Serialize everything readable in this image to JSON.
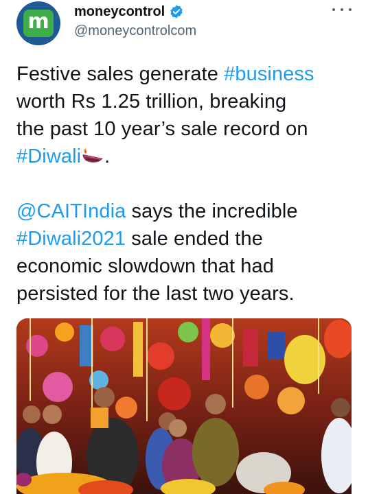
{
  "author": {
    "name": "moneycontrol",
    "handle": "@moneycontrolcom",
    "avatar_letter": "m",
    "verified": true
  },
  "tweet": {
    "p1_l1_a": "Festive sales generate ",
    "p1_l1_tag": "#business",
    "p1_l2": "worth Rs 1.25 trillion, breaking",
    "p1_l3": "the past 10 year’s sale record on",
    "p1_l4_tag": "#Diwali",
    "p1_l4_b": ".",
    "p2_l1_mention": "@CAITIndia",
    "p2_l1_b": " says the incredible",
    "p2_l2_tag": "#Diwali2021",
    "p2_l2_b": " sale ended the",
    "p2_l3": "economic slowdown that had",
    "p2_l4": "persisted for the last two years."
  },
  "media": {
    "description_icon": "festive-market-photo"
  },
  "colors": {
    "link": "#1d9bf0",
    "verified": "#1d9bf0",
    "avatar_ring": "#1d5a96",
    "avatar_fill": "#3fae4a"
  }
}
